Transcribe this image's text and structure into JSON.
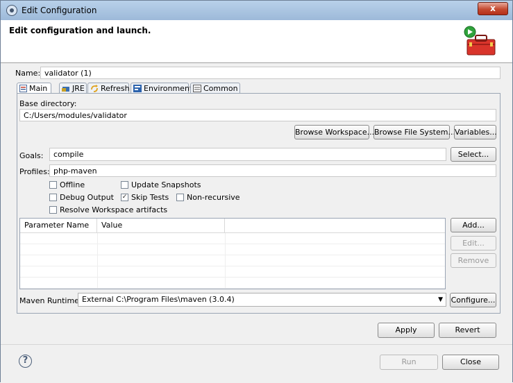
{
  "window": {
    "title": "Edit Configuration",
    "close_glyph": "x"
  },
  "header": {
    "title": "Edit configuration and launch.",
    "icon": "toolbox-run-icon"
  },
  "name": {
    "label": "Name:",
    "value": "validator (1)"
  },
  "tabs": [
    {
      "label": "Main",
      "icon": "maven-main-icon",
      "active": true
    },
    {
      "label": "JRE",
      "icon": "jre-icon",
      "active": false
    },
    {
      "label": "Refresh",
      "icon": "refresh-icon",
      "active": false
    },
    {
      "label": "Environment",
      "icon": "environment-icon",
      "active": false
    },
    {
      "label": "Common",
      "icon": "common-icon",
      "active": false
    }
  ],
  "main": {
    "base_dir_label": "Base directory:",
    "base_dir_value": "C:/Users/modules/validator",
    "browse_workspace": "Browse Workspace...",
    "browse_fs": "Browse File System...",
    "variables": "Variables...",
    "goals_label": "Goals:",
    "goals_value": "compile",
    "select": "Select...",
    "profiles_label": "Profiles:",
    "profiles_value": "php-maven",
    "checkboxes": {
      "offline": {
        "label": "Offline",
        "checked": false
      },
      "update_snapshots": {
        "label": "Update Snapshots",
        "checked": false
      },
      "debug_output": {
        "label": "Debug Output",
        "checked": false
      },
      "skip_tests": {
        "label": "Skip Tests",
        "checked": true
      },
      "non_recursive": {
        "label": "Non-recursive",
        "checked": false
      },
      "resolve_workspace": {
        "label": "Resolve Workspace artifacts",
        "checked": false
      }
    },
    "table": {
      "columns": [
        "Parameter Name",
        "Value"
      ]
    },
    "add": "Add...",
    "edit": "Edit...",
    "remove": "Remove",
    "runtime_label": "Maven Runtime:",
    "runtime_value": "External C:\\Program Files\\maven (3.0.4)",
    "configure": "Configure..."
  },
  "actions": {
    "apply": "Apply",
    "revert": "Revert",
    "run": "Run",
    "close": "Close",
    "help": "?"
  },
  "colors": {
    "title_bar": "#9db9d9",
    "close_red": "#c44a30",
    "toolbox_red": "#d9342b",
    "run_green": "#2fa33b"
  }
}
